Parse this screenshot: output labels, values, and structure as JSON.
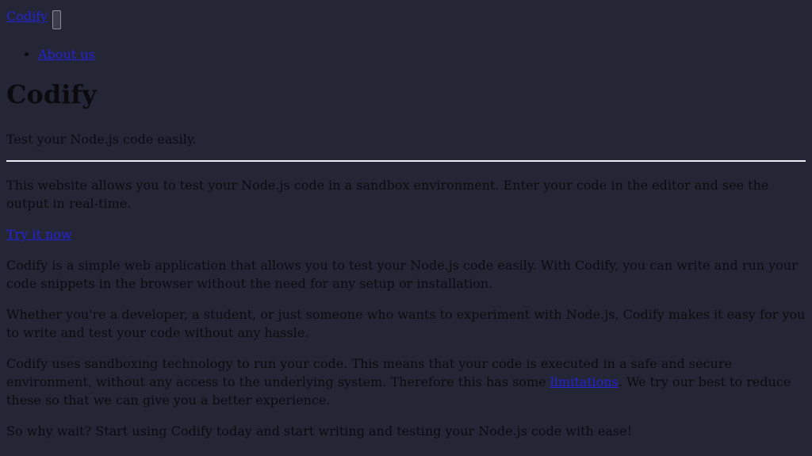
{
  "nav": {
    "brand": "Codify",
    "items": [
      {
        "label": "About us"
      }
    ]
  },
  "hero": {
    "title": "Codify",
    "lead": "Test your Node.js code easily.",
    "intro": "This website allows you to test your Node.js code in a sandbox environment. Enter your code in the editor and see the output in real-time.",
    "cta": "Try it now"
  },
  "about": {
    "p1": "Codify is a simple web application that allows you to test your Node.js code easily. With Codify, you can write and run your code snippets in the browser without the need for any setup or installation.",
    "p2": "Whether you're a developer, a student, or just someone who wants to experiment with Node.js, Codify makes it easy for you to write and test your code without any hassle.",
    "p3_before": "Codify uses sandboxing technology to run your code. This means that your code is executed in a safe and secure environment, without any access to the underlying system. Therefore this has some ",
    "p3_link": "limitations",
    "p3_after": ". We try our best to reduce these so that we can give you a better experience.",
    "p4": "So why wait? Start using Codify today and start writing and testing your Node.js code with ease!"
  },
  "colors": {
    "background": "#242635",
    "text": "#0b0b0f",
    "link": "#2323d6",
    "divider": "#eef0f4"
  }
}
